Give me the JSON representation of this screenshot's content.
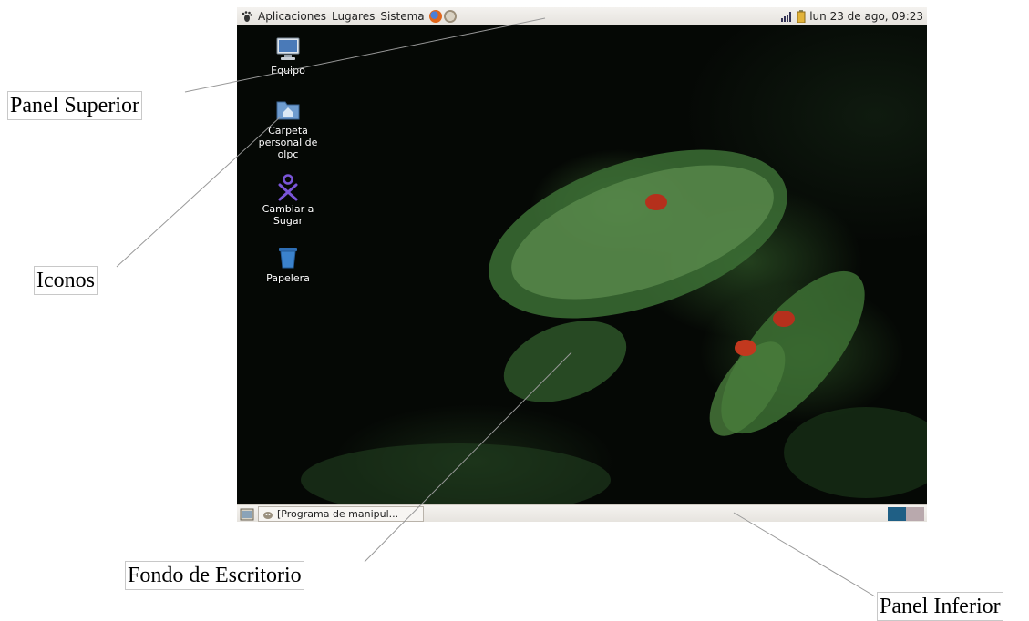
{
  "top_panel": {
    "menus": [
      "Aplicaciones",
      "Lugares",
      "Sistema"
    ],
    "clock": "lun 23 de ago, 09:23"
  },
  "desktop_icons": [
    {
      "label": "Equipo",
      "icon": "computer-icon"
    },
    {
      "label": "Carpeta\npersonal de\nolpc",
      "icon": "home-folder-icon"
    },
    {
      "label": "Cambiar a\nSugar",
      "icon": "sugar-xo-icon"
    },
    {
      "label": "Papelera",
      "icon": "trash-icon"
    }
  ],
  "bottom_panel": {
    "task": "[Programa de manipul..."
  },
  "annotations": {
    "panel_superior": "Panel Superior",
    "iconos": "Iconos",
    "fondo": "Fondo de Escritorio",
    "panel_inferior": "Panel Inferior"
  },
  "colors": {
    "workspace_active": "#1f5f85",
    "workspace_inactive": "#b9a9ad"
  }
}
